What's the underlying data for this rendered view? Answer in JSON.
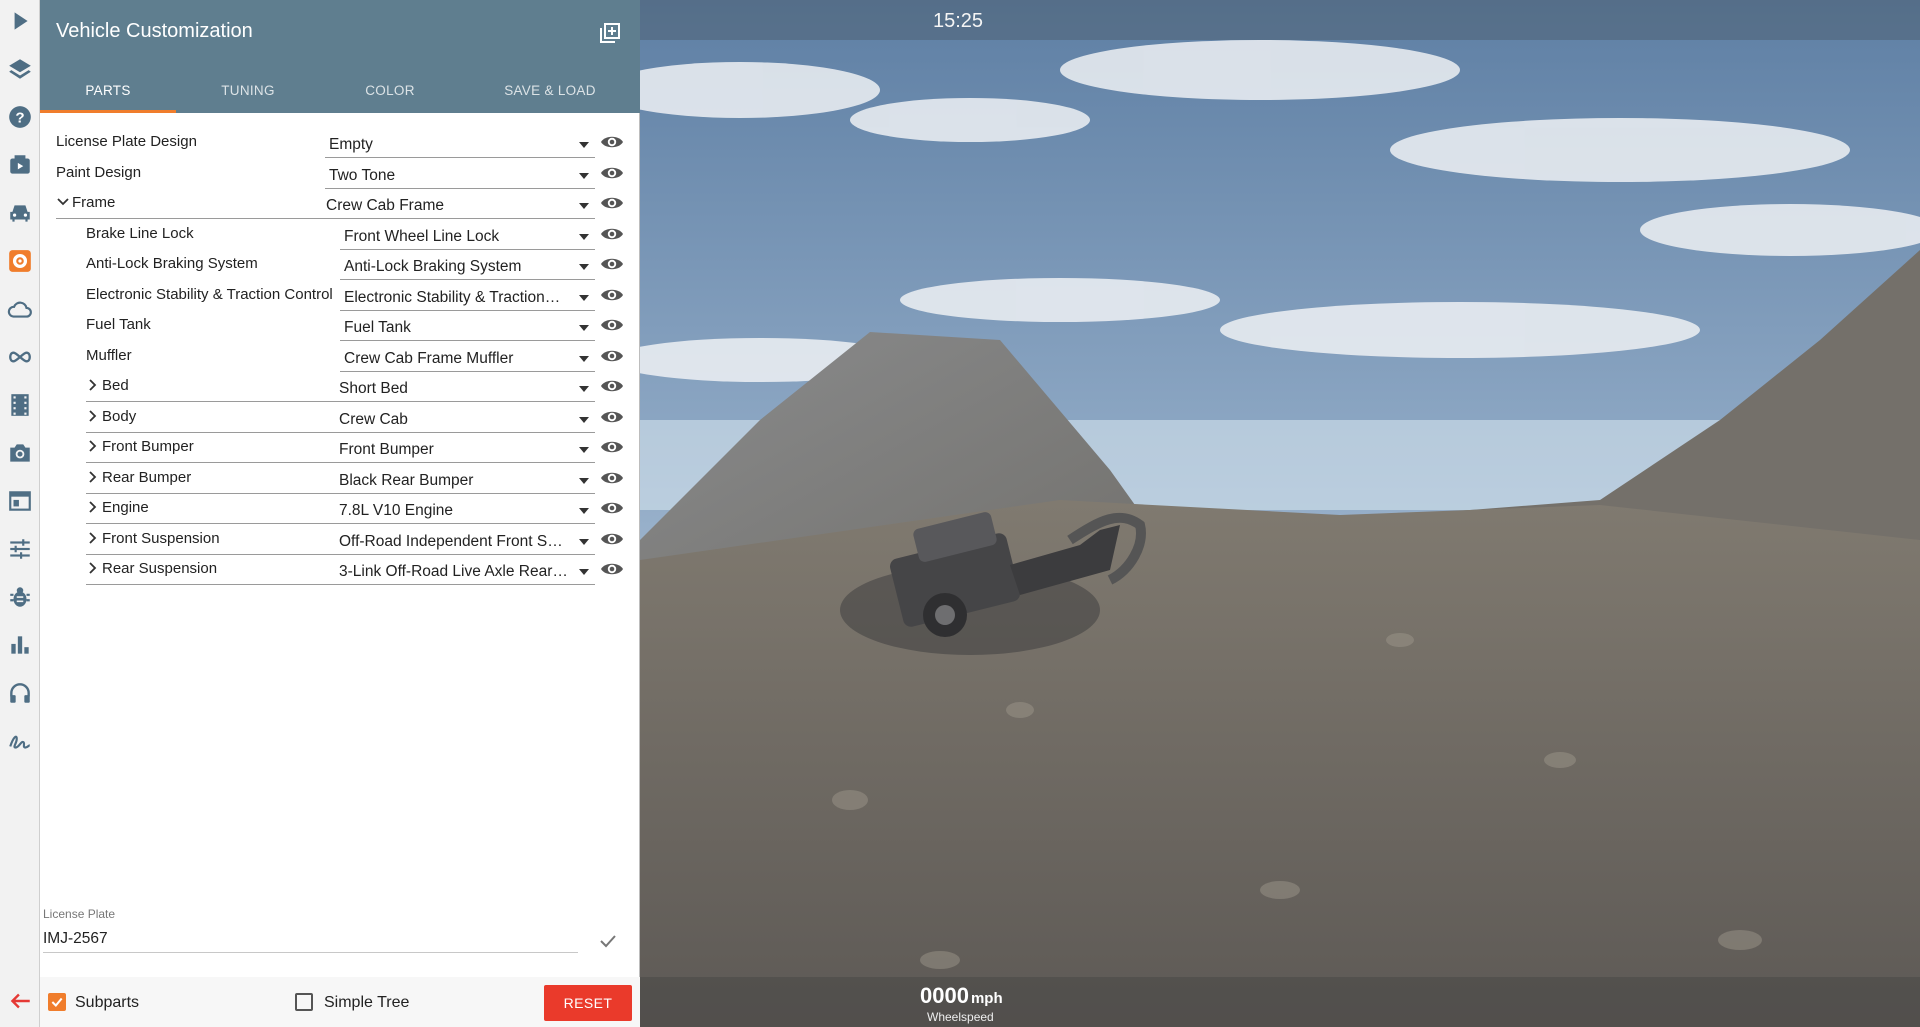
{
  "panel": {
    "title": "Vehicle Customization",
    "tabs": [
      {
        "label": "PARTS",
        "active": true
      },
      {
        "label": "TUNING",
        "active": false
      },
      {
        "label": "COLOR",
        "active": false
      },
      {
        "label": "SAVE & LOAD",
        "active": false
      }
    ]
  },
  "parts": [
    {
      "label": "License Plate Design",
      "value": "Empty",
      "level": 0,
      "expander": "none"
    },
    {
      "label": "Paint Design",
      "value": "Two Tone",
      "level": 0,
      "expander": "none"
    },
    {
      "label": "Frame",
      "value": "Crew Cab Frame",
      "level": 0,
      "expander": "expanded"
    },
    {
      "label": "Brake Line Lock",
      "value": "Front Wheel Line Lock",
      "level": 1,
      "expander": "none"
    },
    {
      "label": "Anti-Lock Braking System",
      "value": "Anti-Lock Braking System",
      "level": 1,
      "expander": "none"
    },
    {
      "label": "Electronic Stability & Traction Control",
      "value": "Electronic Stability & Traction…",
      "level": 1,
      "expander": "none"
    },
    {
      "label": "Fuel Tank",
      "value": "Fuel Tank",
      "level": 1,
      "expander": "none"
    },
    {
      "label": "Muffler",
      "value": "Crew Cab Frame Muffler",
      "level": 1,
      "expander": "none"
    },
    {
      "label": "Bed",
      "value": "Short Bed",
      "level": 1,
      "expander": "collapsed"
    },
    {
      "label": "Body",
      "value": "Crew Cab",
      "level": 1,
      "expander": "collapsed"
    },
    {
      "label": "Front Bumper",
      "value": "Front Bumper",
      "level": 1,
      "expander": "collapsed"
    },
    {
      "label": "Rear Bumper",
      "value": "Black Rear Bumper",
      "level": 1,
      "expander": "collapsed"
    },
    {
      "label": "Engine",
      "value": "7.8L V10 Engine",
      "level": 1,
      "expander": "collapsed"
    },
    {
      "label": "Front Suspension",
      "value": "Off-Road Independent Front S…",
      "level": 1,
      "expander": "collapsed"
    },
    {
      "label": "Rear Suspension",
      "value": "3-Link Off-Road Live Axle Rear…",
      "level": 1,
      "expander": "collapsed"
    }
  ],
  "license_plate": {
    "label": "License Plate",
    "value": "IMJ-2567"
  },
  "footer": {
    "subparts_label": "Subparts",
    "subparts_checked": true,
    "simple_tree_label": "Simple Tree",
    "simple_tree_checked": false,
    "reset_label": "RESET"
  },
  "viewport": {
    "clock": "15:25",
    "speed_value": "0000",
    "speed_unit": "mph",
    "speed_label": "Wheelspeed"
  },
  "rail_icons": [
    "play-icon",
    "layers-icon",
    "help-icon",
    "video-icon",
    "car-icon",
    "gear-icon",
    "cloud-icon",
    "infinity-icon",
    "film-icon",
    "camera-icon",
    "window-icon",
    "sliders-icon",
    "bug-icon",
    "bar-chart-icon",
    "headphones-icon",
    "signature-icon",
    "back-arrow-icon"
  ],
  "colors": {
    "header": "#5f7e8f",
    "accent": "#f07d2c",
    "reset": "#ea3a2b"
  }
}
